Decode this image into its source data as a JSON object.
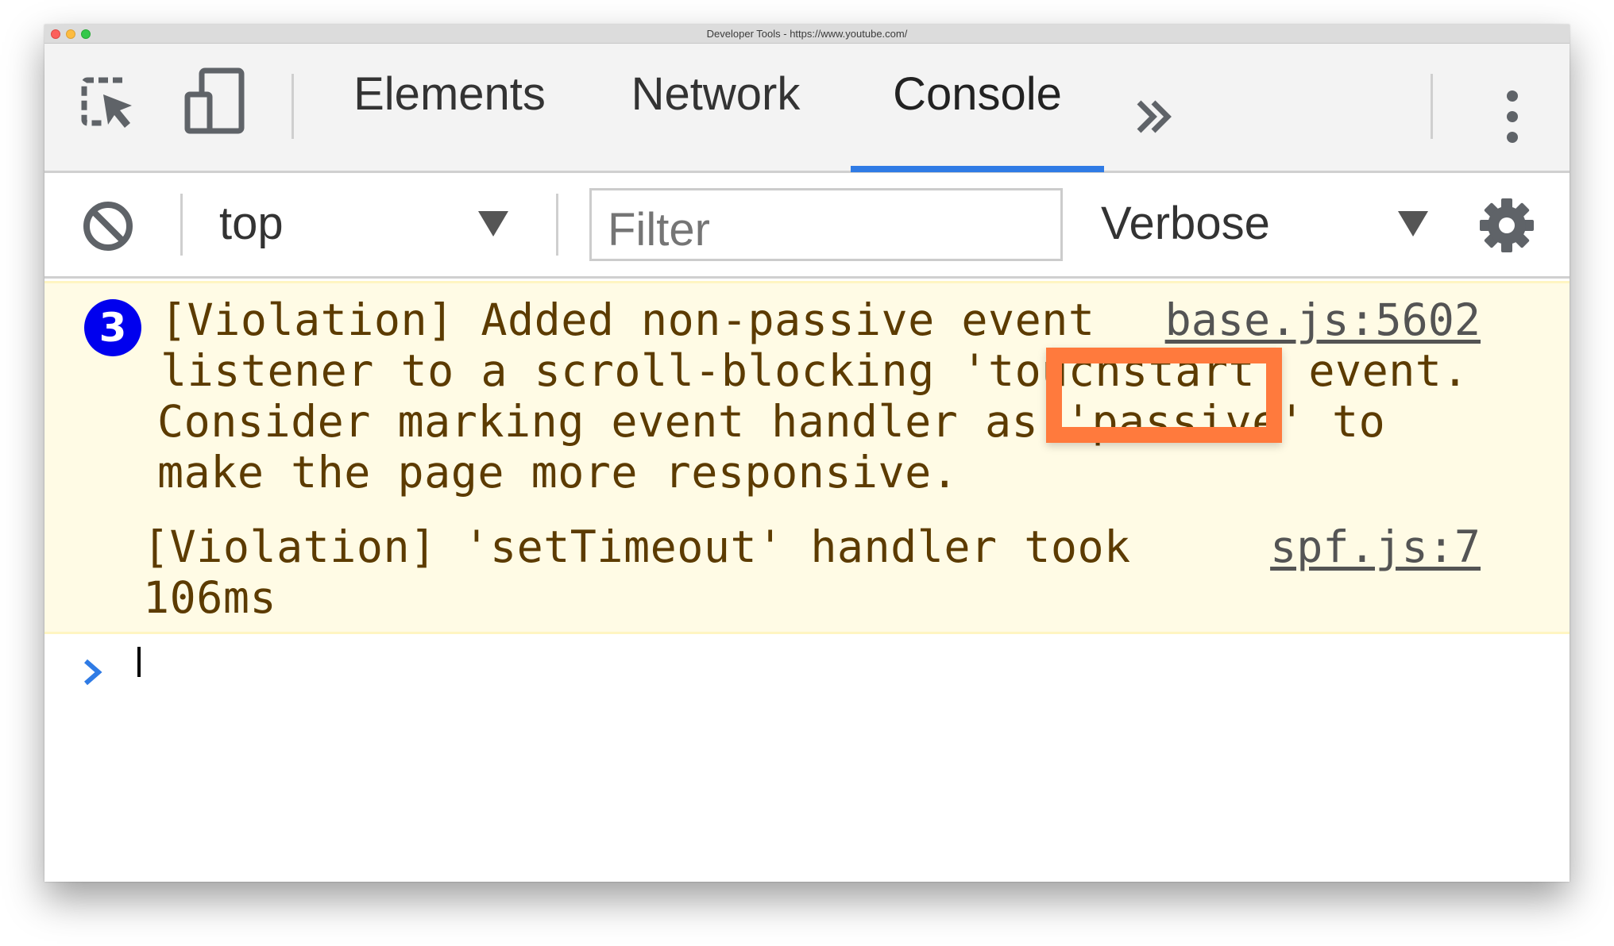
{
  "window": {
    "title": "Developer Tools - https://www.youtube.com/"
  },
  "tabs": [
    {
      "label": "Elements",
      "active": false
    },
    {
      "label": "Network",
      "active": false
    },
    {
      "label": "Console",
      "active": true
    }
  ],
  "toolbar": {
    "context": "top",
    "filter_placeholder": "Filter",
    "level": "Verbose"
  },
  "messages": [
    {
      "count": "3",
      "text_lines": [
        "[Violation] Added non-passive event",
        "listener to a scroll-blocking 'touchstart' event.",
        "Consider marking event handler as 'passive' to",
        "make the page more responsive."
      ],
      "source": "base.js:5602"
    },
    {
      "text_lines": [
        "[Violation] 'setTimeout' handler took",
        "106ms"
      ],
      "source": "spf.js:7"
    }
  ],
  "icons": {
    "inspect": "inspect-element-icon",
    "device": "device-toolbar-icon",
    "more_tabs": "chevron-double-right-icon",
    "menu": "vertical-dots-icon",
    "clear": "clear-console-icon",
    "dropdown": "dropdown-arrow-icon",
    "settings": "gear-icon",
    "prompt": "prompt-chevron-icon"
  },
  "colors": {
    "active_tab_underline": "#2f7be5",
    "warning_background": "#fffbe5",
    "warning_text": "#5c3b00",
    "badge": "#0000ee",
    "annotation_box": "#ff7a3d"
  }
}
